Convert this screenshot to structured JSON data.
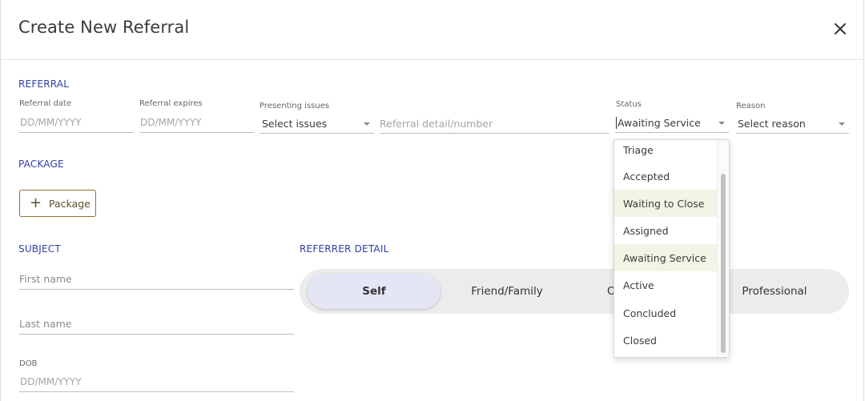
{
  "dialog": {
    "title": "Create New Referral"
  },
  "referral": {
    "section_label": "REFERRAL",
    "referral_date_label": "Referral date",
    "referral_date_placeholder": "DD/MM/YYYY",
    "referral_expires_label": "Referral expires",
    "referral_expires_placeholder": "DD/MM/YYYY",
    "presenting_issues_label": "Presenting issues",
    "presenting_issues_value": "Select issues",
    "referral_detail_placeholder": "Referral detail/number",
    "status_label": "Status",
    "status_value": "Awaiting Service",
    "reason_label": "Reason",
    "reason_value": "Select reason"
  },
  "status_options": [
    {
      "label": "Triage"
    },
    {
      "label": "Accepted"
    },
    {
      "label": "Waiting to Close"
    },
    {
      "label": "Assigned"
    },
    {
      "label": "Awaiting Service"
    },
    {
      "label": "Active"
    },
    {
      "label": "Concluded"
    },
    {
      "label": "Closed"
    }
  ],
  "package": {
    "section_label": "PACKAGE",
    "add_button_label": "Package"
  },
  "subject": {
    "section_label": "SUBJECT",
    "first_name_placeholder": "First name",
    "last_name_placeholder": "Last name",
    "dob_label": "DOB",
    "dob_placeholder": "DD/MM/YYYY"
  },
  "referrer": {
    "section_label": "REFERRER DETAIL",
    "options": [
      "Self",
      "Friend/Family",
      "O",
      "Professional"
    ],
    "selected": "Self"
  },
  "colors": {
    "section": "#2f3ea8",
    "button_border": "#8a7432",
    "segment_selected": "#e4e6f6",
    "option_highlight": "#f4f4e6"
  }
}
